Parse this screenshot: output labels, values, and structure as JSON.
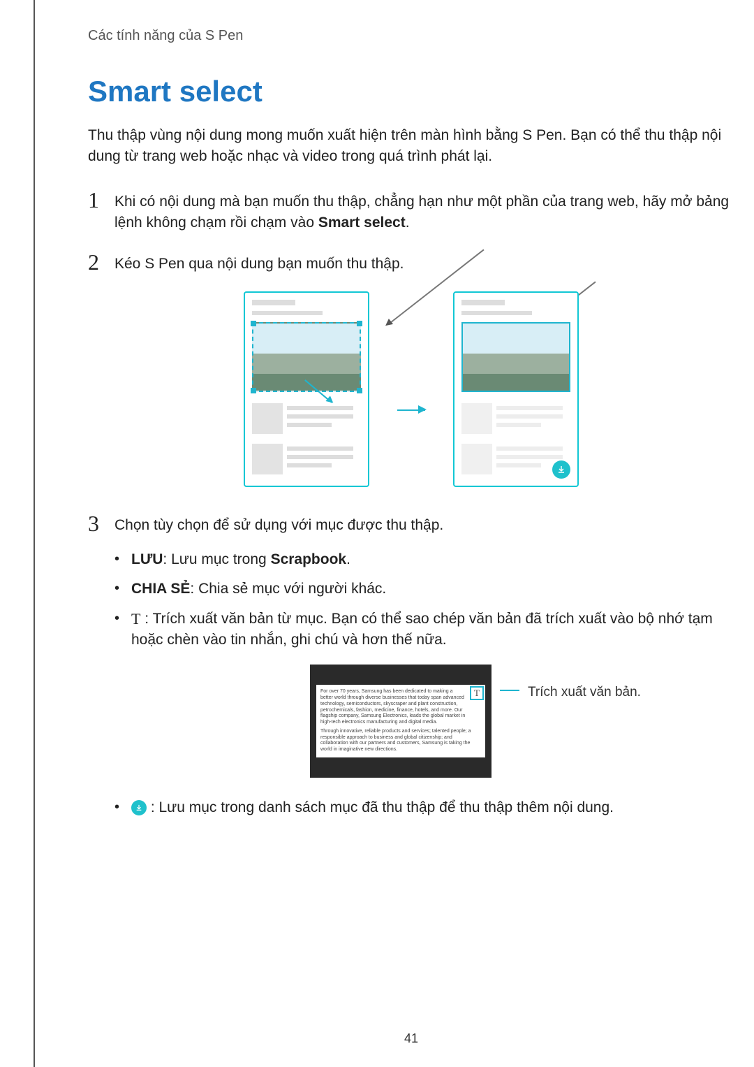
{
  "header": {
    "running": "Các tính năng của S Pen"
  },
  "title": "Smart select",
  "intro": "Thu thập vùng nội dung mong muốn xuất hiện trên màn hình bằng S Pen. Bạn có thể thu thập nội dung từ trang web hoặc nhạc và video trong quá trình phát lại.",
  "steps": {
    "s1": {
      "num": "1",
      "pre": "Khi có nội dung mà bạn muốn thu thập, chẳng hạn như một phần của trang web, hãy mở bảng lệnh không chạm rồi chạm vào ",
      "bold": "Smart select",
      "post": "."
    },
    "s2": {
      "num": "2",
      "text": "Kéo S Pen qua nội dung bạn muốn thu thập."
    },
    "s3": {
      "num": "3",
      "text": "Chọn tùy chọn để sử dụng với mục được thu thập.",
      "b1": {
        "label": "LƯU",
        "tail_a": ": Lưu mục trong ",
        "bold": "Scrapbook",
        "tail_b": "."
      },
      "b2": {
        "label": "CHIA SẺ",
        "tail": ": Chia sẻ mục với người khác."
      },
      "b3": {
        "icon": "T",
        "tail": " : Trích xuất văn bản từ mục. Bạn có thể sao chép văn bản đã trích xuất vào bộ nhớ tạm hoặc chèn vào tin nhắn, ghi chú và hơn thế nữa."
      },
      "b4": {
        "tail": " : Lưu mục trong danh sách mục đã thu thập để thu thập thêm nội dung."
      }
    }
  },
  "figure2": {
    "para1": "For over 70 years, Samsung has been dedicated to making a better world through diverse businesses that today span advanced technology, semiconductors, skyscraper and plant construction, petrochemicals, fashion, medicine, finance, hotels, and more. Our flagship company, Samsung Electronics, leads the global market in high-tech electronics manufacturing and digital media.",
    "para2": "Through innovative, reliable products and services; talented people; a responsible approach to business and global citizenship; and collaboration with our partners and customers, Samsung is taking the world in imaginative new directions.",
    "t_button": "T",
    "callout": "Trích xuất văn bản."
  },
  "page_number": "41"
}
